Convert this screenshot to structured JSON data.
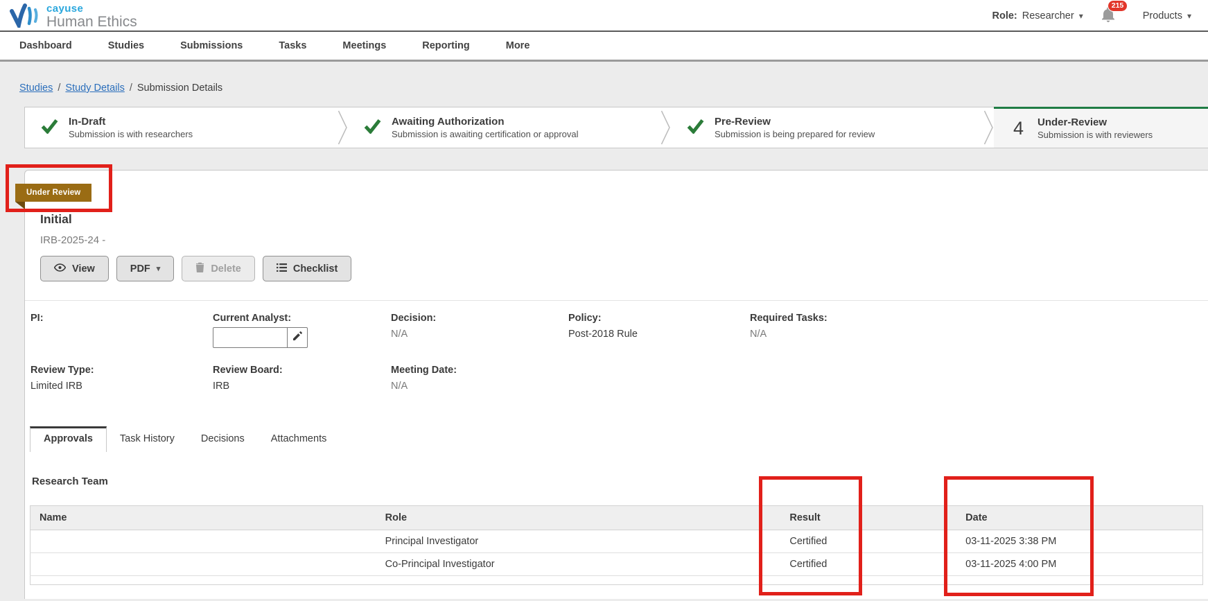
{
  "header": {
    "brand_name": "cayuse",
    "product_name": "Human Ethics",
    "role_label": "Role:",
    "role_value": "Researcher",
    "notifications_count": "215",
    "products_label": "Products"
  },
  "nav": {
    "items": [
      "Dashboard",
      "Studies",
      "Submissions",
      "Tasks",
      "Meetings",
      "Reporting",
      "More"
    ]
  },
  "breadcrumb": {
    "separator": "/",
    "links": [
      "Studies",
      "Study Details"
    ],
    "current": "Submission Details"
  },
  "stepper": {
    "steps": [
      {
        "title": "In-Draft",
        "subtitle": "Submission is with researchers",
        "state": "complete"
      },
      {
        "title": "Awaiting Authorization",
        "subtitle": "Submission is awaiting certification or approval",
        "state": "complete"
      },
      {
        "title": "Pre-Review",
        "subtitle": "Submission is being prepared for review",
        "state": "complete"
      },
      {
        "title": "Under-Review",
        "subtitle": "Submission is with reviewers",
        "state": "current",
        "step_number": "4"
      }
    ]
  },
  "submission": {
    "status_badge": "Under Review",
    "title": "Initial",
    "id": "IRB-2025-24 -",
    "buttons": {
      "view": "View",
      "pdf": "PDF",
      "delete": "Delete",
      "checklist": "Checklist"
    }
  },
  "details": {
    "pi": {
      "label": "PI:",
      "value": ""
    },
    "current_analyst": {
      "label": "Current Analyst:",
      "value": ""
    },
    "decision": {
      "label": "Decision:",
      "value": "N/A"
    },
    "policy": {
      "label": "Policy:",
      "value": "Post-2018 Rule"
    },
    "required_tasks": {
      "label": "Required Tasks:",
      "value": "N/A"
    },
    "review_type": {
      "label": "Review Type:",
      "value": "Limited IRB"
    },
    "review_board": {
      "label": "Review Board:",
      "value": "IRB"
    },
    "meeting_date": {
      "label": "Meeting Date:",
      "value": "N/A"
    }
  },
  "tabs": {
    "active": "Approvals",
    "items": [
      "Approvals",
      "Task History",
      "Decisions",
      "Attachments"
    ]
  },
  "approvals": {
    "section_title": "Research Team",
    "table": {
      "columns": [
        "Name",
        "Role",
        "Result",
        "Date"
      ],
      "rows": [
        [
          "",
          "Principal Investigator",
          "Certified",
          "03-11-2025 3:38 PM"
        ],
        [
          "",
          "Co-Principal Investigator",
          "Certified",
          "03-11-2025 4:00 PM"
        ]
      ]
    }
  },
  "colors": {
    "link_blue": "#2a6ebb",
    "check_green": "#2b7c39",
    "active_step_green": "#1f7c44",
    "ribbon_gold": "#9a6c14",
    "annotation_red": "#e1201a",
    "notification_badge_red": "#e2362a"
  }
}
